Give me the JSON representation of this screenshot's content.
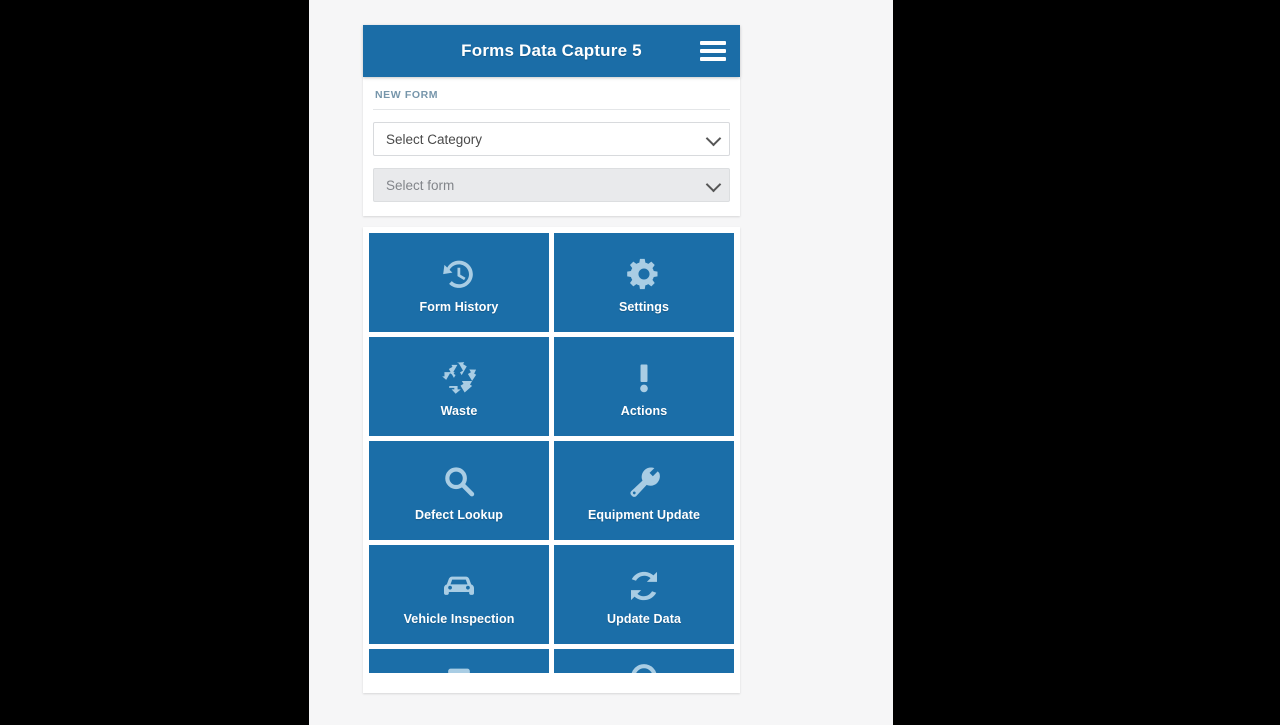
{
  "app": {
    "title": "Forms Data Capture 5",
    "menu_icon": "hamburger-menu-icon",
    "header_color": "#1b6da7",
    "tile_color": "#1b6ea8",
    "icon_color": "#a9cde4",
    "page_background": "#f6f6f7"
  },
  "new_form": {
    "section_label": "NEW FORM",
    "category_select": {
      "value": "Select Category",
      "placeholder": "Select Category",
      "disabled": false
    },
    "form_select": {
      "value": "Select form",
      "placeholder": "Select form",
      "disabled": true
    }
  },
  "tiles": [
    {
      "label": "Form History",
      "icon": "history-clock-icon"
    },
    {
      "label": "Settings",
      "icon": "gear-icon"
    },
    {
      "label": "Waste",
      "icon": "recycle-icon"
    },
    {
      "label": "Actions",
      "icon": "exclamation-mark-icon"
    },
    {
      "label": "Defect Lookup",
      "icon": "magnifier-icon"
    },
    {
      "label": "Equipment Update",
      "icon": "wrench-icon"
    },
    {
      "label": "Vehicle Inspection",
      "icon": "car-icon"
    },
    {
      "label": "Update Data",
      "icon": "refresh-sync-icon"
    },
    {
      "label": "",
      "icon": "partial-icon-left"
    },
    {
      "label": "",
      "icon": "partial-icon-right"
    }
  ]
}
